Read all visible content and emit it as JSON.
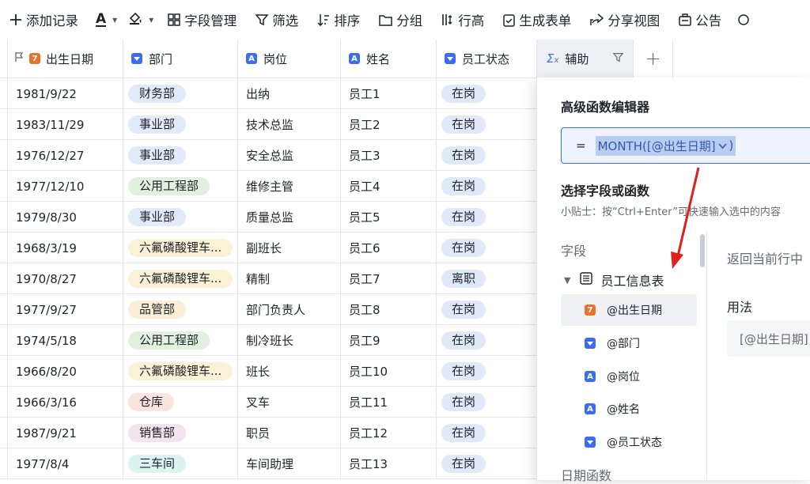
{
  "toolbar": {
    "add_record": "添加记录",
    "field_manage": "字段管理",
    "filter": "筛选",
    "sort": "排序",
    "group": "分组",
    "row_height": "行高",
    "gen_form": "生成表单",
    "share_view": "分享视图",
    "notice": "公告"
  },
  "columns": {
    "birth": "出生日期",
    "dept": "部门",
    "post": "岗位",
    "name": "姓名",
    "status": "员工状态",
    "aux": "辅助",
    "add": "+"
  },
  "rows": [
    {
      "birth": "1981/9/22",
      "dept": "财务部",
      "dept_color": "#e1eaf8",
      "post": "出纳",
      "name": "员工1",
      "status": "在岗"
    },
    {
      "birth": "1983/11/29",
      "dept": "事业部",
      "dept_color": "#e1eaf8",
      "post": "技术总监",
      "name": "员工2",
      "status": "在岗"
    },
    {
      "birth": "1976/12/27",
      "dept": "事业部",
      "dept_color": "#e1eaf8",
      "post": "安全总监",
      "name": "员工3",
      "status": "在岗"
    },
    {
      "birth": "1977/12/10",
      "dept": "公用工程部",
      "dept_color": "#e2f1df",
      "post": "维修主管",
      "name": "员工4",
      "status": "在岗"
    },
    {
      "birth": "1979/8/30",
      "dept": "事业部",
      "dept_color": "#e1eaf8",
      "post": "质量总监",
      "name": "员工5",
      "status": "在岗"
    },
    {
      "birth": "1968/3/19",
      "dept": "六氟磷酸锂车...",
      "dept_color": "#faf1d6",
      "post": "副班长",
      "name": "员工6",
      "status": "在岗"
    },
    {
      "birth": "1970/8/27",
      "dept": "六氟磷酸锂车...",
      "dept_color": "#faf1d6",
      "post": "精制",
      "name": "员工7",
      "status": "离职"
    },
    {
      "birth": "1977/9/27",
      "dept": "品管部",
      "dept_color": "#faeed6",
      "post": "部门负责人",
      "name": "员工8",
      "status": "在岗"
    },
    {
      "birth": "1974/5/18",
      "dept": "公用工程部",
      "dept_color": "#e2f1df",
      "post": "制冷班长",
      "name": "员工9",
      "status": "在岗"
    },
    {
      "birth": "1966/8/20",
      "dept": "六氟磷酸锂车...",
      "dept_color": "#faf1d6",
      "post": "班长",
      "name": "员工10",
      "status": "在岗"
    },
    {
      "birth": "1966/3/16",
      "dept": "仓库",
      "dept_color": "#fbe3e0",
      "post": "叉车",
      "name": "员工11",
      "status": "在岗"
    },
    {
      "birth": "1987/9/21",
      "dept": "销售部",
      "dept_color": "#f3e3ef",
      "post": "职员",
      "name": "员工12",
      "status": "在岗"
    },
    {
      "birth": "1977/8/4",
      "dept": "三车间",
      "dept_color": "#dcf3f0",
      "post": "车间助理",
      "name": "员工13",
      "status": "在岗"
    }
  ],
  "panel": {
    "title": "高级函数编辑器",
    "eq": "=",
    "formula": "MONTH([@出生日期]",
    "formula_close": ")",
    "select_title": "选择字段或函数",
    "tip": "小贴士：按“Ctrl+Enter”可快速输入选中的内容",
    "field_label": "字段",
    "table_name": "员工信息表",
    "fields": [
      "@出生日期",
      "@部门",
      "@岗位",
      "@姓名",
      "@员工状态"
    ],
    "date_func_label": "日期函数",
    "desc": "返回当前行中",
    "usage_label": "用法",
    "usage_example": "[@出生日期]"
  },
  "colors": {
    "accent": "#3a6df0",
    "date_field": "#e8742c",
    "arrow": "#e0201b"
  }
}
